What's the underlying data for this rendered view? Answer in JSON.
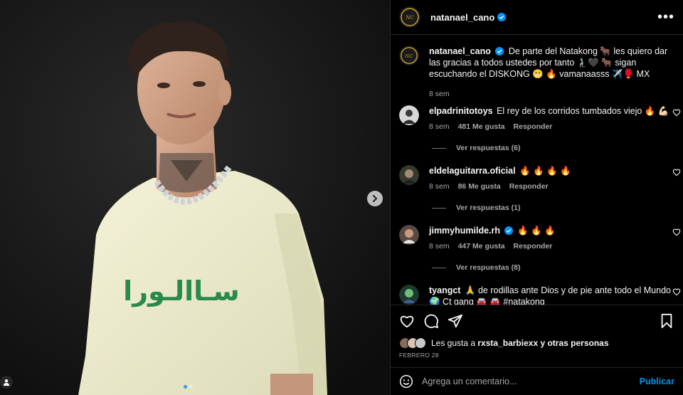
{
  "post": {
    "author": "natanael_cano",
    "caption": "De parte del Natakong 🐂 les quiero dar las gracias a todos ustedes por tanto 🧎🏻‍♂️🖤 🐂 sigan escuchando el DISKONG 😬 🔥 vamanaasss ✈️🥊 MX",
    "age": "8 sem",
    "shirt_text": "سـاالـورا"
  },
  "comments": [
    {
      "user": "elpadrinitotoys",
      "text": "El rey de los corridos tumbados viejo 🔥 💪🏻",
      "age": "8 sem",
      "likes": "481 Me gusta",
      "reply": "Responder",
      "replies": "Ver respuestas (6)"
    },
    {
      "user": "eldelaguitarra.oficial",
      "text": "🔥 🔥 🔥 🔥",
      "age": "8 sem",
      "likes": "86 Me gusta",
      "reply": "Responder",
      "replies": "Ver respuestas (1)"
    },
    {
      "user": "jimmyhumilde.rh",
      "text": "🔥 🔥 🔥",
      "age": "8 sem",
      "likes": "447 Me gusta",
      "reply": "Responder",
      "replies": "Ver respuestas (8)"
    },
    {
      "user": "tyangct",
      "text": "🙏 de rodillas ante Dios y de pie ante todo el Mundo 🌍 Ct gang 🚘 🚘 #natakong"
    }
  ],
  "likes": {
    "prefix": "Les gusta a",
    "user": "rxsta_barbiexx",
    "suffix": "y otras personas"
  },
  "date": "FEBRERO 28",
  "add_comment": {
    "placeholder": "Agrega un comentario...",
    "post_label": "Publicar"
  },
  "icons": {
    "like": "heart-icon",
    "comment": "comment-icon",
    "share": "share-icon",
    "save": "bookmark-icon",
    "emoji": "emoji-icon",
    "more": "more-icon",
    "next": "chevron-right-icon",
    "tag": "user-tag-icon"
  },
  "colors": {
    "accent": "#0095f6",
    "verified": "#0095f6",
    "dot_active": "#3897f0"
  }
}
